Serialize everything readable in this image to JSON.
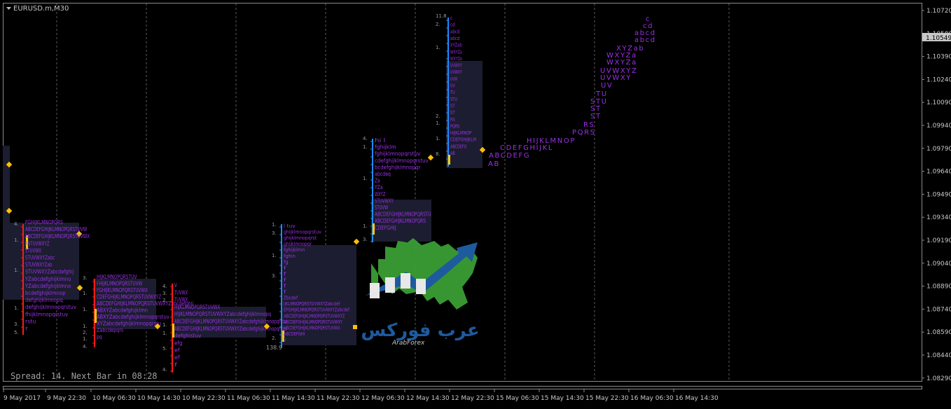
{
  "window": {
    "title": "EURUSD.m,M30",
    "current_price": "1.10549"
  },
  "status": {
    "text": "Spread: 14. Next Bar in 08:28"
  },
  "price_axis": {
    "labels": [
      "1.10720",
      "1.10580",
      "1.10390",
      "1.10240",
      "1.10090",
      "1.09940",
      "1.09790",
      "1.09640",
      "1.09490",
      "1.09340",
      "1.09190",
      "1.09040",
      "1.08890",
      "1.08740",
      "1.08590",
      "1.08440",
      "1.08290"
    ]
  },
  "time_axis": {
    "labels": [
      "9 May 2017",
      "9 May 22:30",
      "10 May 06:30",
      "10 May 14:30",
      "10 May 22:30",
      "11 May 06:30",
      "11 May 14:30",
      "11 May 22:30",
      "12 May 06:30",
      "12 May 14:30",
      "12 May 22:30",
      "15 May 06:30",
      "15 May 14:30",
      "15 May 22:30",
      "16 May 06:30",
      "16 May 14:30"
    ]
  },
  "colors": {
    "background": "#000000",
    "grid": "#5a5a5a",
    "tpo_text": "#9b30e8",
    "profile_box": "#1c1d30",
    "bar_red": "#ff1a1a",
    "bar_blue": "#1e8cff",
    "poc_yellow": "#ffcc00",
    "marker_gold": "#ffc000",
    "logo_green": "#3a9e34",
    "logo_blue": "#1e5a9e"
  },
  "chart_data": {
    "type": "other",
    "symbol": "EURUSD.m",
    "timeframe": "M30",
    "current_price": 1.10549,
    "spread": 14,
    "next_bar_in": "08:28",
    "profiles": [
      {
        "rows": [
          "FGHIJKLMNOPQRS",
          "ABCDEFGHIJKLMNOPQRSTUVW",
          "ABCDEFGHIJKLMNOPQRSTUVWX",
          "RSTUVWXYZ",
          "STUVWX",
          "STUVWXYZabc",
          "STUVWXYZab",
          "STUVWXYZabcdefghij",
          "YZabcdefghijklmno",
          "YZabcdefghijklmno",
          "bcdefghijklmnop",
          "defghijklmnopq",
          "defghijklmnopqrstuv",
          "fhijklmnopqrstuv",
          "rstu",
          "r"
        ],
        "side_labels": [
          "4.",
          "1.",
          "1.",
          "1.",
          "3.",
          "5."
        ]
      },
      {
        "rows": [
          "HIJKLMNOPQRSTUV",
          "FHIJKLMNOPQRSTUVW",
          "FGHIJKLMNOPQRSTUVWX",
          "CDEFGHIJKLMNOPQRSTUVWXYZ",
          "ABCDEFGHIJKLMNOPQRSTUVWXYZabcdefghij",
          "ABXYZabcdefghijklmn",
          "ABXYZabcdefghijklmnopqrstuv",
          "XYZabcdefghijklmnopqrstu",
          "Zabcdepqrs",
          "pq"
        ],
        "side_labels": [
          "3.",
          "1.",
          "1.",
          "1.",
          "2.",
          "1.",
          "4."
        ]
      },
      {
        "rows": [
          "V",
          "TUVWX",
          "TUVWX",
          "HIJKLMNOPQRSTUVWX",
          "HIJKLMNOPQRSTUVWXYZabcdefghijklmnopq",
          "ABCDEFGHIJKLMNOPQRSTUVWXYZabcdefghijklmnopqrstu",
          "ABCDEFGHIJKLMNOPQRSTUVWXYZabcdefghijklmnopqrstu",
          "defghistuv",
          "efg",
          "ef",
          "ef",
          "f"
        ],
        "side_labels": [
          "4.",
          "3.",
          "2.",
          "1.",
          "1.",
          "5.",
          "4."
        ]
      },
      {
        "rows": [
          "l tuv",
          "ghijklmnopqrstuv",
          "ghijklmnopqrst",
          "ghijklmnopqr",
          "fghijklmn",
          "fghin",
          "fg",
          "f",
          "f",
          "f",
          "f",
          "f",
          "Zbcdef",
          "IJKLMNOPQRSTUVWXYZabcdef",
          "EFGHIJKLMNOPQRSTUVWXYZabcdef",
          "ABCDEFGHIJKLMNOPQRSTUVWXYZ",
          "ABCDEFGHIJKLMNOPQRSTUVWXY",
          "ABCDEFGHIJKLMNOPQRSTUVWX",
          "ABCDEFGHI",
          "U"
        ],
        "side_labels": [
          "1.",
          "3.",
          "1.",
          "3.",
          "2."
        ],
        "bottom_label": "138.9"
      },
      {
        "rows": [
          "hi l",
          "fghijklm",
          "fghijklmnopqrstuv",
          "cdefghijklmnopqrstuv",
          "bcdefghijklmnopqr",
          "abcdeq",
          "Za",
          "YZa",
          "WXYZ",
          "STUVWXY",
          "STUVW",
          "ABCDEFGHIJKLMNOPQRSTU",
          "ABCDEFGHIJKLMNOPQRS",
          "CDEFGHIJ"
        ],
        "side_labels": [
          "4.",
          "1.",
          "1.",
          "1.",
          "3."
        ]
      },
      {
        "rows": [
          "c",
          "cd",
          "abcd",
          "abcd",
          "XYZab",
          "WXYZa",
          "WXYZa",
          "UVWXY",
          "UVWXY",
          "UVW",
          "UV",
          "TU",
          "STU",
          "ST",
          "ST",
          "RS",
          "PQRS",
          "HIJKLMNOP",
          "CDEFGHIJKLM",
          "ABCDEFG",
          "AB"
        ],
        "side_labels": [
          "11.8",
          "2.",
          "1.",
          "2.",
          "1.",
          "1.",
          "8."
        ]
      }
    ],
    "live_profile": {
      "rows": [
        "c",
        "cd",
        "abcd",
        "abcd",
        "XYZab",
        "WXYZa",
        "WXYZa",
        "UVWXYZ",
        "UVWXY",
        "UV",
        "TU",
        "STU",
        "ST",
        "ST",
        "RS",
        "PQRS",
        "HIJKLMNOP",
        "CDEFGHIJKL",
        "ABCDEFG",
        "AB"
      ]
    },
    "logo": {
      "text": "عرب فوركس",
      "subtext": "ArabForex"
    }
  }
}
